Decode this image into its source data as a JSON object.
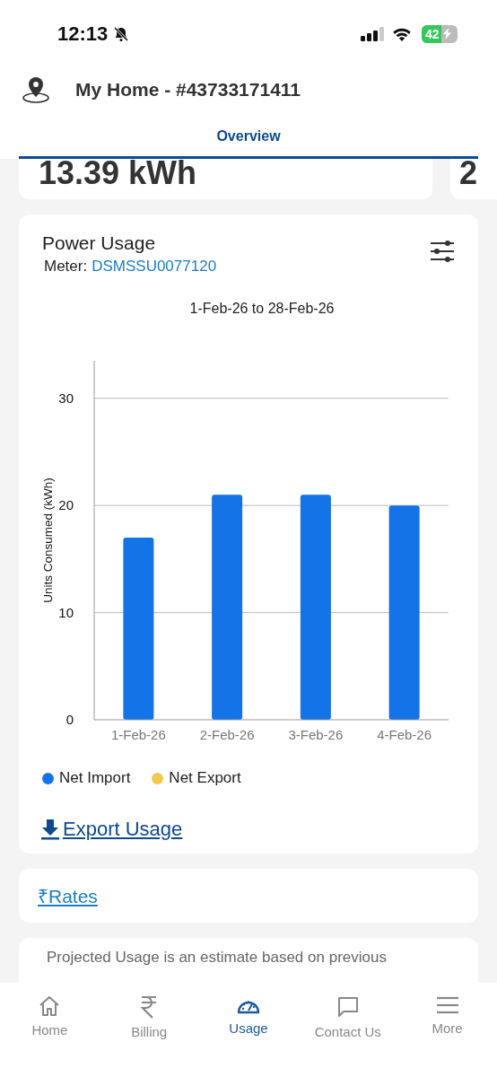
{
  "status_bar": {
    "time": "12:13",
    "battery": "42"
  },
  "header": {
    "title": "My Home - #43733171411"
  },
  "tabs": [
    {
      "label": "Overview",
      "selected": true
    }
  ],
  "summary_cards": [
    {
      "value": "13.39 kWh"
    },
    {
      "value": "2"
    }
  ],
  "power_usage": {
    "title": "Power Usage",
    "meter_label": "Meter:",
    "meter_id": "DSMSSU0077120",
    "date_range": "1-Feb-26 to 28-Feb-26",
    "chart_data": {
      "type": "bar",
      "grid": true,
      "ylabel": "Units Consumed (kWh)",
      "categories": [
        "1-Feb-26",
        "2-Feb-26",
        "3-Feb-26",
        "4-Feb-26"
      ],
      "ylim": [
        0,
        33.5
      ],
      "yticks": [
        0,
        10,
        20,
        30
      ],
      "series": [
        {
          "name": "Net Import",
          "color": "#1473e6",
          "values": [
            17,
            21,
            21,
            20
          ]
        },
        {
          "name": "Net Export",
          "color": "#f2c94c",
          "values": [
            null,
            null,
            null,
            null
          ]
        }
      ]
    },
    "export_link": "Export Usage"
  },
  "rates_link": "₹Rates",
  "projected_note": "Projected Usage is an estimate based on previous",
  "nav": [
    {
      "label": "Home",
      "selected": false
    },
    {
      "label": "Billing",
      "selected": false
    },
    {
      "label": "Usage",
      "selected": true
    },
    {
      "label": "Contact Us",
      "selected": false
    },
    {
      "label": "More",
      "selected": false
    }
  ]
}
